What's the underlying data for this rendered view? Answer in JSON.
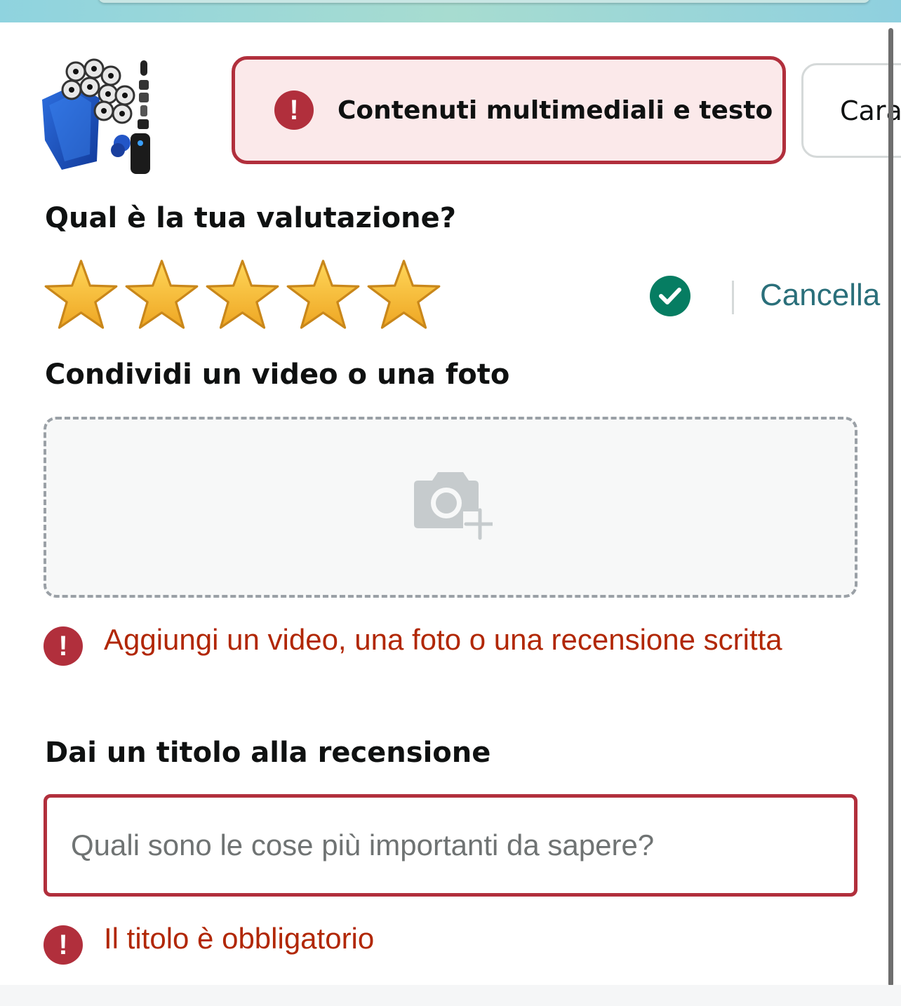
{
  "tabs": {
    "media_text": {
      "label": "Contenuti multimediali e testo",
      "state": "error"
    },
    "features": {
      "label": "Carat"
    }
  },
  "rating": {
    "heading": "Qual è la tua valutazione?",
    "stars_selected": 5,
    "stars_total": 5,
    "clear_label": "Cancella",
    "confirmed": true
  },
  "media": {
    "heading": "Condividi un video o una foto",
    "error": {
      "icon": "!",
      "text": "Aggiungi un video, una foto o una recensione scritta"
    }
  },
  "review_title": {
    "heading": "Dai un titolo alla recensione",
    "placeholder": "Quali sono le cose più importanti da sapere?",
    "value": "",
    "error": {
      "icon": "!",
      "text": "Il titolo è obbligatorio"
    }
  },
  "colors": {
    "error_red": "#b12f3c",
    "error_text": "#b12704",
    "star_gold": "#f2b632",
    "success_green": "#067d62",
    "link_teal": "#2a6f7a"
  },
  "icons": {
    "product": "product-thumbnail",
    "tab_alert": "alert-icon",
    "confirm": "check-circle-icon",
    "upload": "camera-add-icon",
    "field_alert": "alert-icon"
  }
}
